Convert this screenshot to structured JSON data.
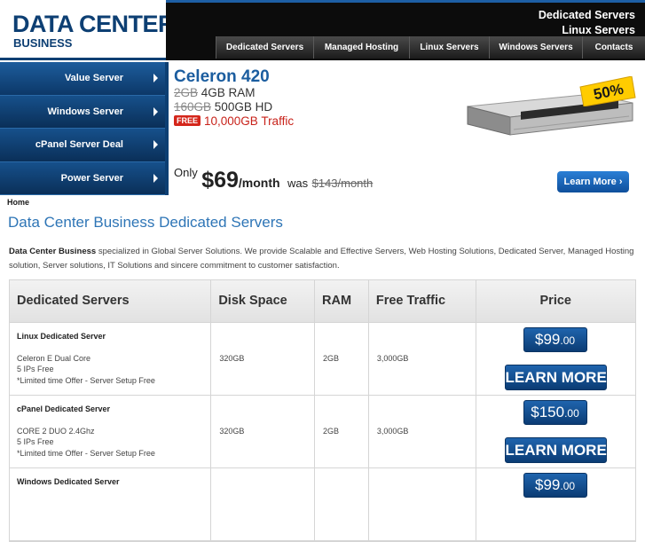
{
  "logo": {
    "main": "DATA CENTER",
    "sub": "BUSINESS"
  },
  "header_links": [
    "Dedicated Servers",
    "Linux Servers"
  ],
  "nav": [
    "Dedicated Servers",
    "Managed Hosting",
    "Linux Servers",
    "Windows Servers",
    "Contacts"
  ],
  "sidebar": [
    "Value Server",
    "Windows Server",
    "cPanel Server Deal",
    "Power Server"
  ],
  "banner": {
    "title": "Celeron 420",
    "ram_old": "2GB",
    "ram_new": "4GB RAM",
    "hd_old": "160GB",
    "hd_new": "500GB HD",
    "free_badge": "FREE",
    "traffic": "10,000GB Traffic",
    "only": "Only",
    "price": "$69",
    "per": "/month",
    "was": "was",
    "old_price": "$143/month",
    "learn_more": "Learn More",
    "badge": "50%"
  },
  "breadcrumb": "Home",
  "page_title": "Data Center Business Dedicated Servers",
  "intro": {
    "brand": "Data Center Business",
    "text": " specialized in Global Server Solutions. We provide Scalable and Effective Servers, Web Hosting Solutions, Dedicated Server, Managed Hosting solution, Server solutions, IT Solutions and sincere commitment to customer satisfaction."
  },
  "table": {
    "headers": [
      "Dedicated Servers",
      "Disk Space",
      "RAM",
      "Free Traffic",
      "Price"
    ],
    "rows": [
      {
        "name": "Linux Dedicated Server",
        "cpu": "Celeron E Dual Core",
        "ips": "5 IPs Free",
        "offer": "*Limited time Offer - Server Setup Free",
        "disk": "320GB",
        "ram": "2GB",
        "traffic": "3,000GB",
        "price": "$99",
        "cents": ".00",
        "learn": "LEARN MORE"
      },
      {
        "name": "cPanel Dedicated Server",
        "cpu": "CORE 2 DUO 2.4Ghz",
        "ips": "5 IPs Free",
        "offer": "*Limited time Offer - Server Setup Free",
        "disk": "320GB",
        "ram": "2GB",
        "traffic": "3,000GB",
        "price": "$150",
        "cents": ".00",
        "learn": "LEARN MORE"
      },
      {
        "name": "Windows Dedicated Server",
        "price": "$99",
        "cents": ".00"
      }
    ]
  }
}
